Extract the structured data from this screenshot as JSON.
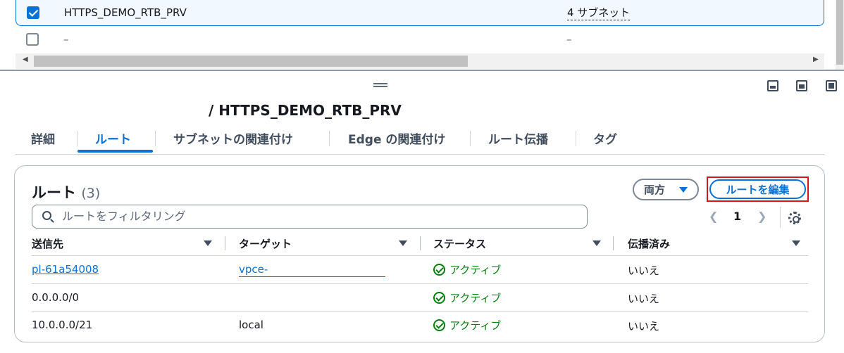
{
  "top_list": {
    "rows": [
      {
        "name": "HTTPS_DEMO_RTB_PRV",
        "subnets": "4 サブネット",
        "selected": true
      },
      {
        "name": "–",
        "subnets": "–",
        "selected": false
      }
    ]
  },
  "detail": {
    "title": "/ HTTPS_DEMO_RTB_PRV",
    "tabs": [
      "詳細",
      "ルート",
      "サブネットの関連付け",
      "Edge の関連付け",
      "ルート伝播",
      "タグ"
    ],
    "active_tab": "ルート"
  },
  "routes": {
    "title": "ルート",
    "count": "(3)",
    "filter_button": "両方",
    "edit_button": "ルートを編集",
    "search_placeholder": "ルートをフィルタリング",
    "page": "1",
    "columns": [
      "送信先",
      "ターゲット",
      "ステータス",
      "伝播済み"
    ],
    "rows": [
      {
        "destination": "pl-61a54008",
        "target": "vpce-",
        "status": "アクティブ",
        "propagated": "いいえ"
      },
      {
        "destination": "0.0.0.0/0",
        "target": "",
        "status": "アクティブ",
        "propagated": "いいえ"
      },
      {
        "destination": "10.0.0.0/21",
        "target": "local",
        "status": "アクティブ",
        "propagated": "いいえ"
      }
    ]
  },
  "colors": {
    "accent": "#0972d3",
    "success": "#037f0c",
    "highlight": "#d1181f"
  }
}
